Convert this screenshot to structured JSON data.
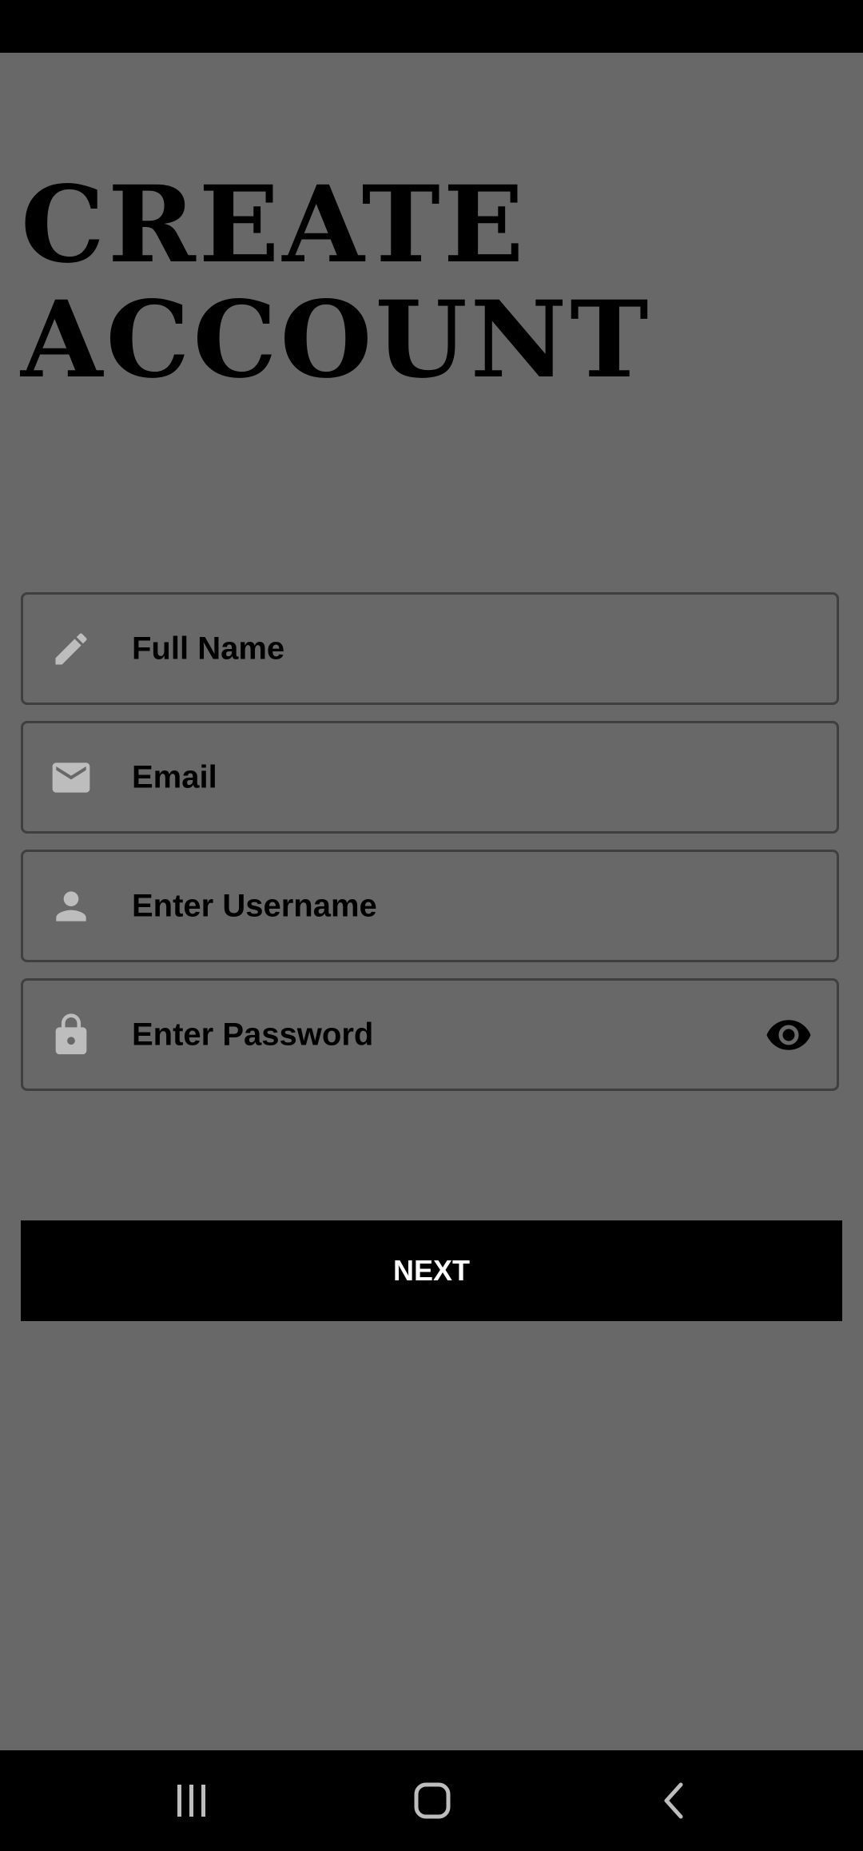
{
  "header": {
    "title_line1": "CREATE",
    "title_line2": "ACCOUNT"
  },
  "form": {
    "fields": [
      {
        "label": "Full Name",
        "icon": "pencil-icon"
      },
      {
        "label": "Email",
        "icon": "mail-icon"
      },
      {
        "label": "Enter Username",
        "icon": "person-icon"
      },
      {
        "label": "Enter Password",
        "icon": "lock-icon",
        "trailing_icon": "eye-icon"
      }
    ],
    "next_label": "NEXT"
  },
  "nav": {
    "items": [
      "recent-apps-icon",
      "home-icon",
      "back-icon"
    ]
  },
  "colors": {
    "background": "#686868",
    "button": "#000000",
    "button_text": "#ffffff",
    "icon": "#bdbdbd",
    "field_border": "#3f3f3f"
  }
}
